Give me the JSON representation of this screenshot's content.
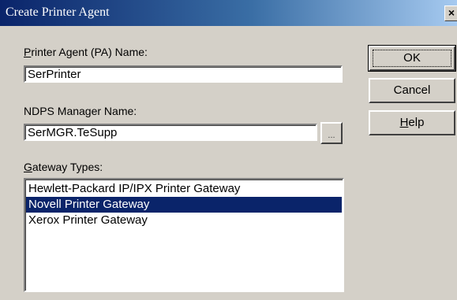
{
  "dialog": {
    "title": "Create Printer Agent",
    "close_label": "×"
  },
  "pa_name": {
    "label_mnemonic": "P",
    "label_rest": "rinter Agent (PA) Name:",
    "value": "SerPrinter"
  },
  "manager": {
    "label": "NDPS Manager Name:",
    "value": "SerMGR.TeSupp",
    "browse_label": "..."
  },
  "gateway": {
    "label_mnemonic": "G",
    "label_rest": "ateway Types:",
    "items": [
      {
        "label": "Hewlett-Packard IP/IPX Printer Gateway",
        "selected": false
      },
      {
        "label": "Novell Printer Gateway",
        "selected": true
      },
      {
        "label": "Xerox Printer Gateway",
        "selected": false
      }
    ]
  },
  "buttons": {
    "ok": "OK",
    "cancel": "Cancel",
    "help_mnemonic": "H",
    "help_rest": "elp"
  },
  "colors": {
    "face": "#d4d0c8",
    "titlebar_start": "#0a246a",
    "titlebar_end": "#a6caf0",
    "selection": "#0a246a"
  }
}
